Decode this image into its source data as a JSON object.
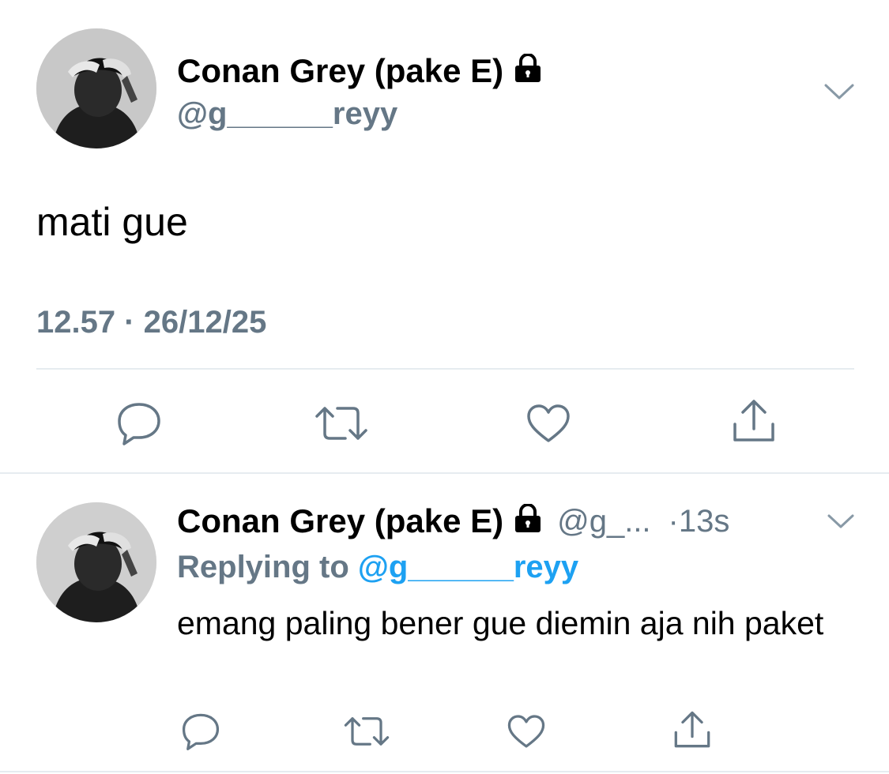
{
  "main_tweet": {
    "display_name": "Conan Grey (pake E)",
    "handle": "@g______reyy",
    "text": "mati gue",
    "timestamp": "12.57 · 26/12/25",
    "icons": {
      "locked": "lock-icon",
      "menu": "chevron-down-icon",
      "reply": "reply-icon",
      "retweet": "retweet-icon",
      "like": "heart-icon",
      "share": "share-icon"
    }
  },
  "reply_tweet": {
    "display_name": "Conan Grey (pake E)",
    "handle": "@g_...",
    "time": "·13s",
    "replying_to_label": "Replying to",
    "replying_to_handle": "@g______reyy",
    "text": "emang paling bener gue diemin aja nih paket"
  },
  "colors": {
    "secondary_text": "#657786",
    "mention_blue": "#1da1f2",
    "divider": "#e6ecf0",
    "icon_gray": "#657786"
  }
}
